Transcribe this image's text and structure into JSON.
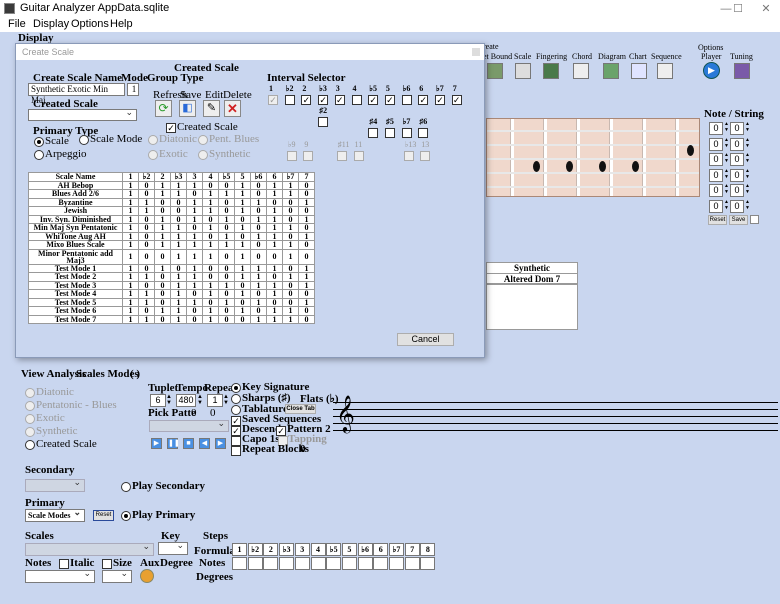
{
  "window": {
    "title": "Guitar Analyzer  AppData.sqlite",
    "min": "—",
    "max": "☐",
    "close": "✕"
  },
  "menu": [
    "File",
    "Display",
    "Options",
    "Help"
  ],
  "display_label": "Display",
  "toolbar": {
    "create_partial": "reate",
    "labels": [
      "et Bound",
      "Scale",
      "Fingering",
      "Chord",
      "Diagram",
      "Chart",
      "Sequence",
      "Options",
      "Player",
      "Tuning"
    ]
  },
  "dialog": {
    "title": "Create Scale",
    "heading": "Created Scale",
    "create_scale_name_label": "Create Scale Name",
    "mode_label": "Mode",
    "name_value": "Synthetic Exotic Min Maj",
    "mode_value": "1",
    "created_scale_label": "Created Scale",
    "group_type_label": "Group Type",
    "buttons": {
      "refresh": "Refresh",
      "save": "Save",
      "edit": "Edit",
      "delete": "Delete",
      "cancel": "Cancel"
    },
    "created_scale_check": "Created Scale",
    "group_opts": [
      "Diatonic",
      "Pent. Blues",
      "Exotic",
      "Synthetic"
    ],
    "primary_type_label": "Primary Type",
    "primary_types": [
      "Scale",
      "Scale Mode",
      "Arpeggio"
    ],
    "interval_selector_label": "Interval Selector",
    "intervals_top": [
      "1",
      "♭2",
      "2",
      "♭3",
      "3",
      "4",
      "♭5",
      "5",
      "♭6",
      "6",
      "♭7",
      "7"
    ],
    "intervals_top_checked": [
      true,
      false,
      true,
      true,
      true,
      false,
      true,
      true,
      false,
      true,
      true,
      true
    ],
    "intervals_mid": [
      "♯2",
      "♯4",
      "♯5",
      "♭7",
      "♯6"
    ],
    "intervals_low": [
      "♭9",
      "9",
      "♯11",
      "11",
      "♭13",
      "13"
    ],
    "table": {
      "headers": [
        "Scale Name",
        "1",
        "♭2",
        "2",
        "♭3",
        "3",
        "4",
        "♭5",
        "5",
        "♭6",
        "6",
        "♭7",
        "7"
      ],
      "rows": [
        [
          "AH Bebop",
          "1",
          "0",
          "1",
          "1",
          "1",
          "0",
          "0",
          "1",
          "0",
          "1",
          "1",
          "0"
        ],
        [
          "Blues Add 2/6",
          "1",
          "0",
          "1",
          "1",
          "0",
          "1",
          "1",
          "1",
          "0",
          "1",
          "1",
          "0"
        ],
        [
          "Byzantine",
          "1",
          "1",
          "0",
          "0",
          "1",
          "1",
          "0",
          "1",
          "1",
          "0",
          "0",
          "1"
        ],
        [
          "Jewish",
          "1",
          "1",
          "0",
          "0",
          "1",
          "1",
          "0",
          "1",
          "0",
          "1",
          "0",
          "0"
        ],
        [
          "Inv. Syn. Diminished",
          "1",
          "0",
          "1",
          "0",
          "1",
          "0",
          "1",
          "0",
          "1",
          "1",
          "0",
          "1"
        ],
        [
          "Min Maj Syn Pentatonic",
          "1",
          "0",
          "1",
          "1",
          "0",
          "1",
          "0",
          "1",
          "0",
          "1",
          "1",
          "0"
        ],
        [
          "WhiTone Aug AH",
          "1",
          "0",
          "1",
          "1",
          "1",
          "0",
          "1",
          "0",
          "1",
          "1",
          "0",
          "1"
        ],
        [
          "Mixo Blues Scale",
          "1",
          "0",
          "1",
          "1",
          "1",
          "1",
          "1",
          "1",
          "0",
          "1",
          "1",
          "0"
        ],
        [
          "Minor Pentatonic add Maj3",
          "1",
          "0",
          "0",
          "1",
          "1",
          "1",
          "0",
          "1",
          "0",
          "0",
          "1",
          "0"
        ],
        [
          "Test Mode 1",
          "1",
          "0",
          "1",
          "0",
          "1",
          "0",
          "0",
          "1",
          "1",
          "1",
          "0",
          "1"
        ],
        [
          "Test Mode 2",
          "1",
          "1",
          "0",
          "1",
          "1",
          "0",
          "0",
          "1",
          "1",
          "0",
          "1",
          "1"
        ],
        [
          "Test Mode 3",
          "1",
          "0",
          "0",
          "1",
          "1",
          "1",
          "1",
          "0",
          "1",
          "1",
          "0",
          "1"
        ],
        [
          "Test Mode 4",
          "1",
          "1",
          "0",
          "1",
          "0",
          "1",
          "0",
          "1",
          "0",
          "1",
          "0",
          "0"
        ],
        [
          "Test Mode 5",
          "1",
          "1",
          "0",
          "1",
          "1",
          "0",
          "1",
          "0",
          "1",
          "0",
          "0",
          "1"
        ],
        [
          "Test Mode 6",
          "1",
          "0",
          "1",
          "1",
          "0",
          "1",
          "0",
          "1",
          "0",
          "1",
          "1",
          "0"
        ],
        [
          "Test Mode 7",
          "1",
          "1",
          "0",
          "1",
          "0",
          "1",
          "0",
          "0",
          "1",
          "1",
          "1",
          "0"
        ]
      ]
    }
  },
  "note_string": {
    "label": "Note / String",
    "values": [
      [
        "0",
        "0"
      ],
      [
        "0",
        "0"
      ],
      [
        "0",
        "0"
      ],
      [
        "0",
        "0"
      ],
      [
        "0",
        "0"
      ],
      [
        "0",
        "0"
      ]
    ],
    "reset": "Reset",
    "save": "Save"
  },
  "scale_table": {
    "col1": "Synthetic",
    "col2": "Altered Dom 7"
  },
  "view_analysis": {
    "title": "View Analysis",
    "modes": "Scales Modes",
    "paren": "(    )",
    "options": [
      "Diatonic",
      "Pentatonic - Blues",
      "Exotic",
      "Synthetic",
      "Created Scale"
    ]
  },
  "controls": {
    "tuplet": "Tuplet",
    "tempo": "Tempo",
    "repeat": "Repeat",
    "tuplet_val": "6",
    "tempo_val": "480",
    "repeat_val": "1",
    "pick_pattern": "Pick Patte",
    "pick_a": "0",
    "pick_b": "0",
    "key_signature": "Key Signature",
    "sharps": "Sharps (♯)",
    "flats": "Flats (♭)",
    "tablature": "Tablature",
    "close_tab": "Close Tab",
    "saved_sequences": "Saved Sequences",
    "descend": "Descend",
    "pattern2": "Pattern 2",
    "capo": "Capo 1st",
    "tapping": "Tapping",
    "repeat_blocks": "Repeat Blocks",
    "repeat_blocks_val": "0"
  },
  "secondary": {
    "label": "Secondary",
    "play": "Play Secondary"
  },
  "primary": {
    "label": "Primary",
    "value": "Scale Modes",
    "reset": "Reset",
    "play": "Play Primary"
  },
  "bottom": {
    "scales": "Scales",
    "key": "Key",
    "steps": "Steps",
    "formula": "Formula",
    "notes_lbl": "Notes",
    "degree": "Degree",
    "degrees": "Degrees",
    "notes": "Notes",
    "italic": "Italic",
    "size": "Size",
    "aux": "Aux",
    "formula_cells": [
      "1",
      "♭2",
      "2",
      "♭3",
      "3",
      "4",
      "♭5",
      "5",
      "♭6",
      "6",
      "♭7",
      "7",
      "8"
    ]
  },
  "colors": {
    "bg": "#c9d6ef",
    "fretboard": "#f0d8cc",
    "accent": "#4a90e2"
  }
}
